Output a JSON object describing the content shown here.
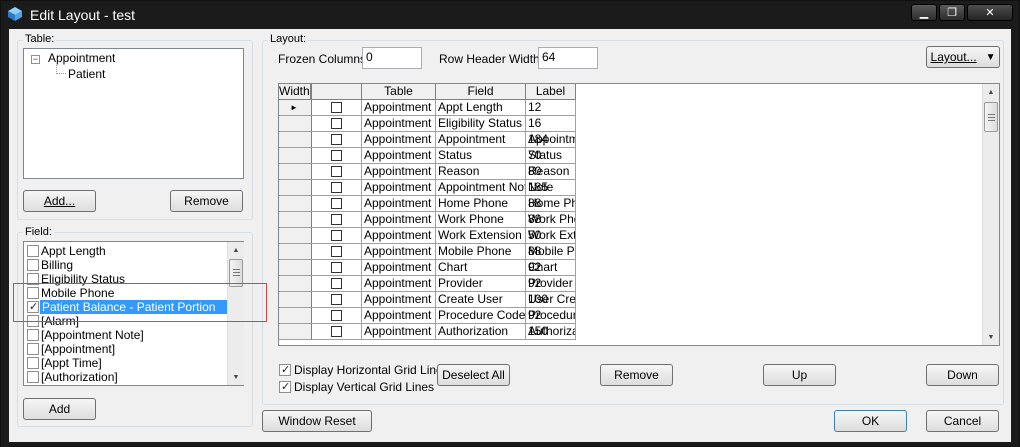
{
  "window": {
    "title": "Edit Layout - test",
    "min": "▁",
    "max": "❐",
    "close": "✕"
  },
  "table_group": {
    "label": "Table:",
    "tree": [
      {
        "label": "Appointment",
        "expander": "−"
      },
      {
        "label": "Patient"
      }
    ],
    "add_label": "Add...",
    "remove_label": "Remove"
  },
  "field_group": {
    "label": "Field:",
    "items": [
      {
        "label": "Appt Length",
        "checked": false
      },
      {
        "label": "Billing",
        "checked": false
      },
      {
        "label": "Eligibility Status",
        "checked": false
      },
      {
        "label": "Mobile Phone",
        "checked": false
      },
      {
        "label": "Patient Balance - Patient Portion",
        "checked": true,
        "selected": true
      },
      {
        "label": "[Alarm]",
        "checked": false
      },
      {
        "label": "[Appointment Note]",
        "checked": false
      },
      {
        "label": "[Appointment]",
        "checked": false
      },
      {
        "label": "[Appt Time]",
        "checked": false
      },
      {
        "label": "[Authorization]",
        "checked": false
      }
    ],
    "add_label": "Add"
  },
  "layout_group": {
    "label": "Layout:",
    "frozen_label": "Frozen Columns:",
    "frozen_value": "0",
    "row_header_label": "Row Header Width:",
    "row_header_value": "64",
    "layout_button": "Layout...",
    "layout_arrow": "▼"
  },
  "grid": {
    "columns": [
      "Table",
      "Field",
      "Label",
      "Width"
    ],
    "current_row_marker": "►",
    "rows": [
      {
        "table": "Appointment",
        "field": "Appt Length",
        "label": "",
        "width": "12"
      },
      {
        "table": "Appointment",
        "field": "Eligibility Status",
        "label": "",
        "width": "16"
      },
      {
        "table": "Appointment",
        "field": "Appointment",
        "label": "Appointment",
        "width": "184"
      },
      {
        "table": "Appointment",
        "field": "Status",
        "label": "Status",
        "width": "70"
      },
      {
        "table": "Appointment",
        "field": "Reason",
        "label": "Reason",
        "width": "80"
      },
      {
        "table": "Appointment",
        "field": "Appointment Note",
        "label": "Note",
        "width": "185"
      },
      {
        "table": "Appointment",
        "field": "Home Phone",
        "label": "Home Phone",
        "width": "88"
      },
      {
        "table": "Appointment",
        "field": "Work Phone",
        "label": "Work Phone",
        "width": "88"
      },
      {
        "table": "Appointment",
        "field": "Work Extension",
        "label": "Work Ext",
        "width": "50"
      },
      {
        "table": "Appointment",
        "field": "Mobile Phone",
        "label": "Mobile Phone",
        "width": "88"
      },
      {
        "table": "Appointment",
        "field": "Chart",
        "label": "Chart",
        "width": "92"
      },
      {
        "table": "Appointment",
        "field": "Provider",
        "label": "Provider",
        "width": "92"
      },
      {
        "table": "Appointment",
        "field": "Create User",
        "label": "User Created",
        "width": "100"
      },
      {
        "table": "Appointment",
        "field": "Procedure Code",
        "label": "Procedure",
        "width": "92"
      },
      {
        "table": "Appointment",
        "field": "Authorization",
        "label": "Authorization",
        "width": "150"
      }
    ]
  },
  "options": {
    "horizontal_grid": {
      "label": "Display Horizontal Grid Lines",
      "checked": true
    },
    "vertical_grid": {
      "label": "Display Vertical Grid Lines",
      "checked": true
    },
    "deselect_all": "Deselect All",
    "remove": "Remove",
    "up": "Up",
    "down": "Down"
  },
  "footer": {
    "window_reset": "Window Reset",
    "ok": "OK",
    "cancel": "Cancel"
  },
  "colors": {
    "selection": "#3399ff",
    "highlight_box": "#d64545",
    "titlebar": "#1b1b1b"
  }
}
